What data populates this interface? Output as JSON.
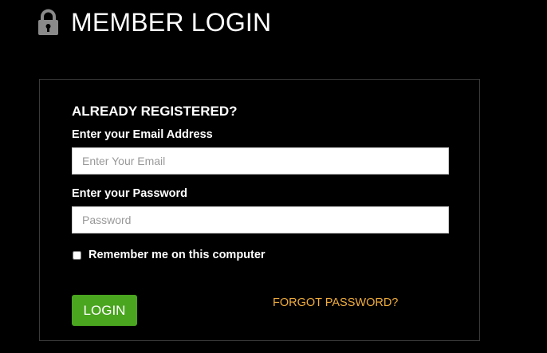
{
  "header": {
    "title": "MEMBER LOGIN",
    "icon": "lock-icon"
  },
  "form": {
    "section_title": "ALREADY REGISTERED?",
    "email": {
      "label": "Enter your Email Address",
      "placeholder": "Enter Your Email",
      "value": ""
    },
    "password": {
      "label": "Enter your Password",
      "placeholder": "Password",
      "value": ""
    },
    "remember": {
      "label": "Remember me on this computer",
      "checked": false
    },
    "login_label": "LOGIN",
    "forgot_label": "FORGOT PASSWORD?"
  },
  "colors": {
    "background": "#000000",
    "accent_green": "#4aa51f",
    "link_orange": "#f0ad3c",
    "panel_border": "#3a3a3a"
  }
}
